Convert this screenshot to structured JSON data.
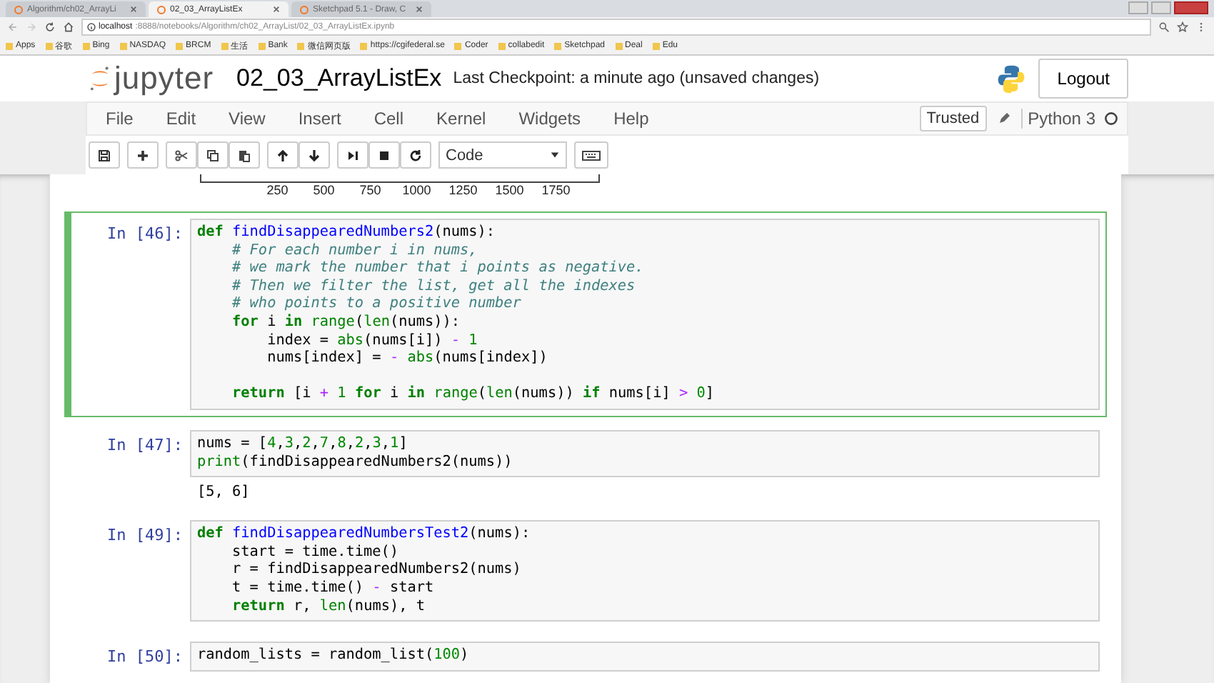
{
  "browser": {
    "tabs": [
      {
        "title": "Algorithm/ch02_ArrayLi",
        "selected": false
      },
      {
        "title": "02_03_ArrayListEx",
        "selected": true
      },
      {
        "title": "Sketchpad 5.1 - Draw, C",
        "selected": false
      }
    ],
    "url": {
      "host": "localhost",
      "rest": ":8888/notebooks/Algorithm/ch02_ArrayList/02_03_ArrayListEx.ipynb"
    },
    "bookmarks": [
      "Apps",
      "谷歌",
      "Bing",
      "NASDAQ",
      "BRCM",
      "生活",
      "Bank",
      "微信网页版",
      "https://cgifederal.se",
      "Coder",
      "collabedit",
      "Sketchpad",
      "Deal",
      "Edu"
    ]
  },
  "header": {
    "logo": "jupyter",
    "notebook_name": "02_03_ArrayListEx",
    "checkpoint": "Last Checkpoint: a minute ago (unsaved changes)",
    "logout": "Logout"
  },
  "menu": [
    "File",
    "Edit",
    "View",
    "Insert",
    "Cell",
    "Kernel",
    "Widgets",
    "Help"
  ],
  "kernel": {
    "trusted": "Trusted",
    "name": "Python 3"
  },
  "toolbar": {
    "cell_type": "Code"
  },
  "plot_axis": {
    "tick_labels": [
      "250",
      "500",
      "750",
      "1000",
      "1250",
      "1500",
      "1750"
    ]
  },
  "cells": [
    {
      "prompt": "In [46]:",
      "selected": true,
      "lines": [
        {
          "tokens": [
            {
              "kind": "keyword",
              "text": "def"
            },
            {
              "kind": "function",
              "text": " findDisappearedNumbers2"
            },
            {
              "kind": "plain",
              "text": "(nums):"
            }
          ]
        },
        {
          "tokens": [
            {
              "kind": "comment",
              "text": "    # For each number i in nums,"
            }
          ]
        },
        {
          "tokens": [
            {
              "kind": "comment",
              "text": "    # we mark the number that i points as negative."
            }
          ]
        },
        {
          "tokens": [
            {
              "kind": "comment",
              "text": "    # Then we filter the list, get all the indexes"
            }
          ]
        },
        {
          "tokens": [
            {
              "kind": "comment",
              "text": "    # who points to a positive number"
            }
          ]
        },
        {
          "tokens": [
            {
              "kind": "keyword",
              "text": "    for"
            },
            {
              "kind": "plain",
              "text": " i "
            },
            {
              "kind": "keyword",
              "text": "in"
            },
            {
              "kind": "builtin",
              "text": " range"
            },
            {
              "kind": "plain",
              "text": "("
            },
            {
              "kind": "builtin",
              "text": "len"
            },
            {
              "kind": "plain",
              "text": "(nums)):"
            }
          ]
        },
        {
          "tokens": [
            {
              "kind": "plain",
              "text": "        index = "
            },
            {
              "kind": "builtin",
              "text": "abs"
            },
            {
              "kind": "plain",
              "text": "(nums[i]) "
            },
            {
              "kind": "operator",
              "text": "-"
            },
            {
              "kind": "number",
              "text": " 1"
            }
          ]
        },
        {
          "tokens": [
            {
              "kind": "plain",
              "text": "        nums[index] = "
            },
            {
              "kind": "operator",
              "text": "-"
            },
            {
              "kind": "builtin",
              "text": " abs"
            },
            {
              "kind": "plain",
              "text": "(nums[index])"
            }
          ]
        },
        {
          "blank_before": true,
          "tokens": [
            {
              "kind": "keyword",
              "text": "    return"
            },
            {
              "kind": "plain",
              "text": " [i "
            },
            {
              "kind": "operator",
              "text": "+"
            },
            {
              "kind": "number",
              "text": " 1"
            },
            {
              "kind": "keyword",
              "text": " for"
            },
            {
              "kind": "plain",
              "text": " i "
            },
            {
              "kind": "keyword",
              "text": "in"
            },
            {
              "kind": "builtin",
              "text": " range"
            },
            {
              "kind": "plain",
              "text": "("
            },
            {
              "kind": "builtin",
              "text": "len"
            },
            {
              "kind": "plain",
              "text": "(nums)) "
            },
            {
              "kind": "keyword",
              "text": "if"
            },
            {
              "kind": "plain",
              "text": " nums[i] "
            },
            {
              "kind": "operator",
              "text": ">"
            },
            {
              "kind": "number",
              "text": " 0"
            },
            {
              "kind": "plain",
              "text": "]"
            }
          ]
        }
      ]
    },
    {
      "prompt": "In [47]:",
      "selected": false,
      "lines": [
        {
          "tokens": [
            {
              "kind": "plain",
              "text": "nums = ["
            },
            {
              "kind": "number",
              "text": "4"
            },
            {
              "kind": "plain",
              "text": ","
            },
            {
              "kind": "number",
              "text": "3"
            },
            {
              "kind": "plain",
              "text": ","
            },
            {
              "kind": "number",
              "text": "2"
            },
            {
              "kind": "plain",
              "text": ","
            },
            {
              "kind": "number",
              "text": "7"
            },
            {
              "kind": "plain",
              "text": ","
            },
            {
              "kind": "number",
              "text": "8"
            },
            {
              "kind": "plain",
              "text": ","
            },
            {
              "kind": "number",
              "text": "2"
            },
            {
              "kind": "plain",
              "text": ","
            },
            {
              "kind": "number",
              "text": "3"
            },
            {
              "kind": "plain",
              "text": ","
            },
            {
              "kind": "number",
              "text": "1"
            },
            {
              "kind": "plain",
              "text": "]"
            }
          ]
        },
        {
          "tokens": [
            {
              "kind": "builtin",
              "text": "print"
            },
            {
              "kind": "plain",
              "text": "(findDisappearedNumbers2(nums))"
            }
          ]
        }
      ],
      "output": "[5, 6]"
    },
    {
      "prompt": "In [49]:",
      "selected": false,
      "lines": [
        {
          "tokens": [
            {
              "kind": "keyword",
              "text": "def"
            },
            {
              "kind": "function",
              "text": " findDisappearedNumbersTest2"
            },
            {
              "kind": "plain",
              "text": "(nums):"
            }
          ]
        },
        {
          "tokens": [
            {
              "kind": "plain",
              "text": "    start = time.time()"
            }
          ]
        },
        {
          "tokens": [
            {
              "kind": "plain",
              "text": "    r = findDisappearedNumbers2(nums)"
            }
          ]
        },
        {
          "tokens": [
            {
              "kind": "plain",
              "text": "    t = time.time() "
            },
            {
              "kind": "operator",
              "text": "-"
            },
            {
              "kind": "plain",
              "text": " start"
            }
          ]
        },
        {
          "tokens": [
            {
              "kind": "keyword",
              "text": "    return"
            },
            {
              "kind": "plain",
              "text": " r, "
            },
            {
              "kind": "builtin",
              "text": "len"
            },
            {
              "kind": "plain",
              "text": "(nums), t"
            }
          ]
        }
      ]
    },
    {
      "prompt": "In [50]:",
      "selected": false,
      "lines": [
        {
          "tokens": [
            {
              "kind": "plain",
              "text": "random_lists = random_list("
            },
            {
              "kind": "number",
              "text": "100"
            },
            {
              "kind": "plain",
              "text": ")"
            }
          ]
        }
      ]
    }
  ]
}
